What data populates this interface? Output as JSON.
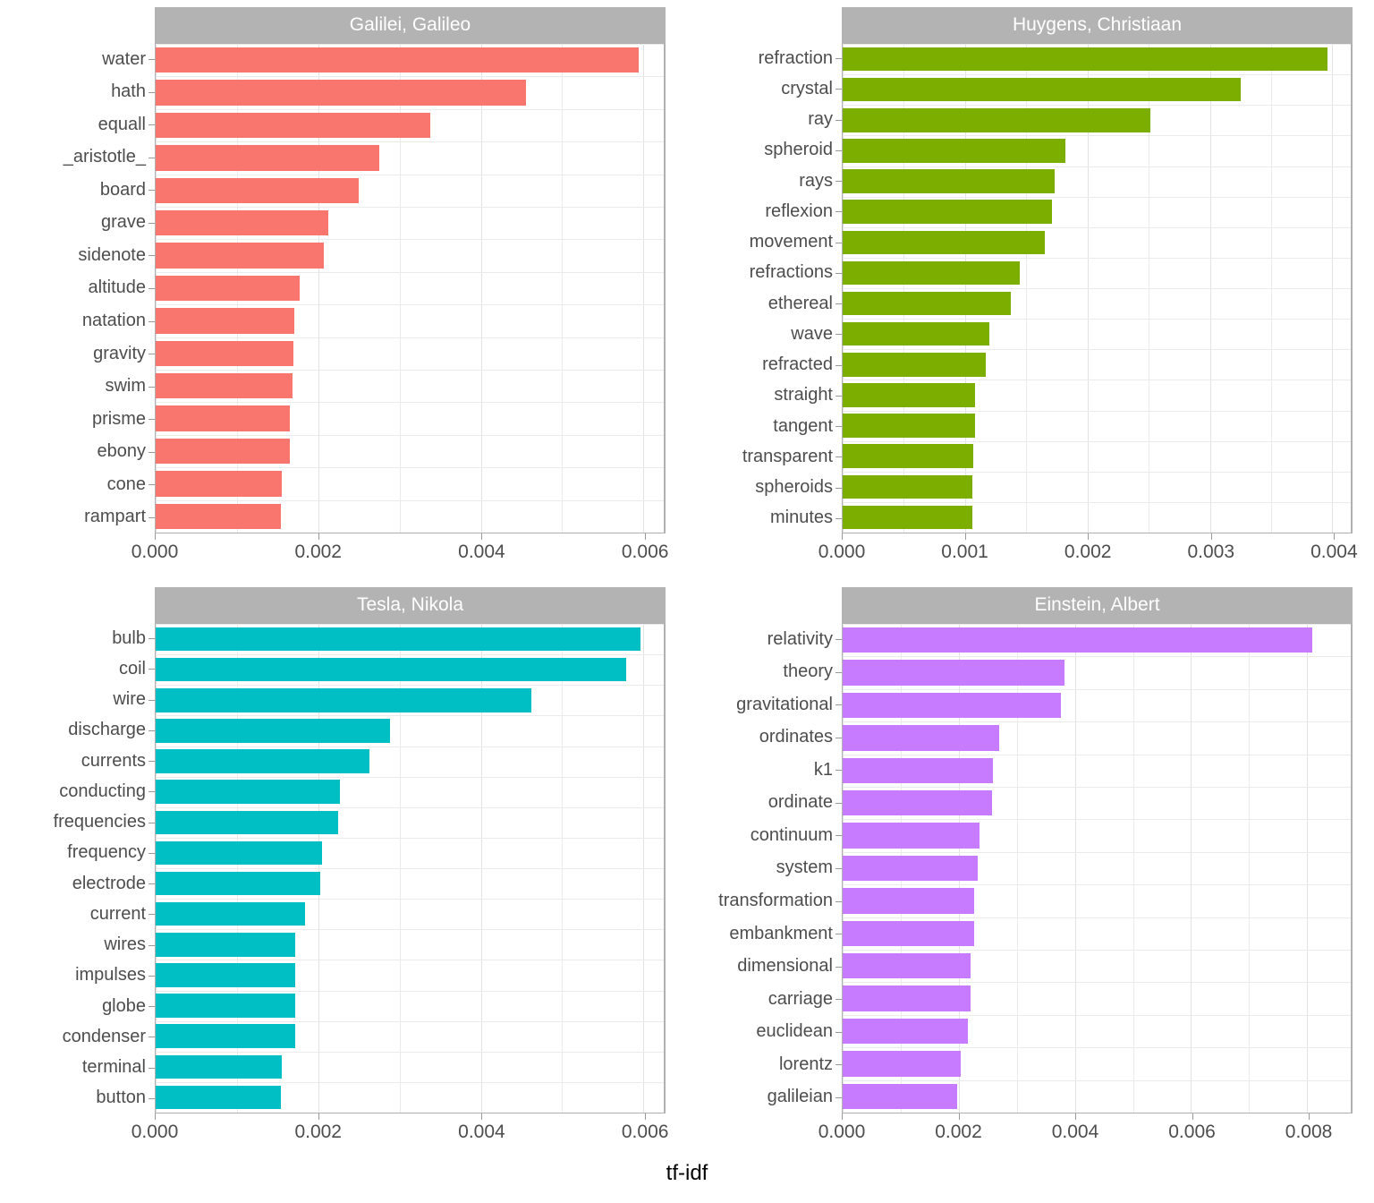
{
  "chart_data": {
    "type": "bar",
    "title": "",
    "xlabel": "tf-idf",
    "ylabel": "",
    "orientation": "horizontal",
    "facet_layout": "2x2",
    "grid": true,
    "legend": "none",
    "panels": [
      {
        "facet_label": "Galilei, Galileo",
        "color": "#F8766D",
        "xlim": [
          0,
          0.00625
        ],
        "xticks": [
          0.0,
          0.002,
          0.004,
          0.006
        ],
        "xtick_labels": [
          "0.000",
          "0.002",
          "0.004",
          "0.006"
        ],
        "categories": [
          "water",
          "hath",
          "equall",
          "_aristotle_",
          "board",
          "grave",
          "sidenote",
          "altitude",
          "natation",
          "gravity",
          "swim",
          "prisme",
          "ebony",
          "cone",
          "rampart"
        ],
        "values": [
          0.00594,
          0.00455,
          0.00338,
          0.00275,
          0.0025,
          0.00212,
          0.00207,
          0.00177,
          0.00171,
          0.0017,
          0.00168,
          0.00165,
          0.00165,
          0.00155,
          0.00154
        ]
      },
      {
        "facet_label": "Huygens, Christiaan",
        "color": "#7CAE00",
        "xlim": [
          0,
          0.00415
        ],
        "xticks": [
          0.0,
          0.001,
          0.002,
          0.003,
          0.004
        ],
        "xtick_labels": [
          "0.000",
          "0.001",
          "0.002",
          "0.003",
          "0.004"
        ],
        "categories": [
          "refraction",
          "crystal",
          "ray",
          "spheroid",
          "rays",
          "reflexion",
          "movement",
          "refractions",
          "ethereal",
          "wave",
          "refracted",
          "straight",
          "tangent",
          "transparent",
          "spheroids",
          "minutes"
        ],
        "values": [
          0.00396,
          0.00325,
          0.00251,
          0.00182,
          0.00173,
          0.00171,
          0.00165,
          0.00145,
          0.00137,
          0.0012,
          0.00117,
          0.00108,
          0.00108,
          0.00107,
          0.00106,
          0.00106
        ]
      },
      {
        "facet_label": "Tesla, Nikola",
        "color": "#00BFC4",
        "xlim": [
          0,
          0.00625
        ],
        "xticks": [
          0.0,
          0.002,
          0.004,
          0.006
        ],
        "xtick_labels": [
          "0.000",
          "0.002",
          "0.004",
          "0.006"
        ],
        "categories": [
          "bulb",
          "coil",
          "wire",
          "discharge",
          "currents",
          "conducting",
          "frequencies",
          "frequency",
          "electrode",
          "current",
          "wires",
          "impulses",
          "globe",
          "condenser",
          "terminal",
          "button"
        ],
        "values": [
          0.00596,
          0.00579,
          0.00462,
          0.00288,
          0.00263,
          0.00227,
          0.00224,
          0.00205,
          0.00203,
          0.00184,
          0.00172,
          0.00172,
          0.00172,
          0.00172,
          0.00155,
          0.00154
        ]
      },
      {
        "facet_label": "Einstein, Albert",
        "color": "#C77CFF",
        "xlim": [
          0,
          0.00875
        ],
        "xticks": [
          0.0,
          0.002,
          0.004,
          0.006,
          0.008
        ],
        "xtick_labels": [
          "0.000",
          "0.002",
          "0.004",
          "0.006",
          "0.008"
        ],
        "categories": [
          "relativity",
          "theory",
          "gravitational",
          "ordinates",
          "k1",
          "ordinate",
          "continuum",
          "system",
          "transformation",
          "embankment",
          "dimensional",
          "carriage",
          "euclidean",
          "lorentz",
          "galileian"
        ],
        "values": [
          0.00808,
          0.00382,
          0.00376,
          0.0027,
          0.00259,
          0.00257,
          0.00235,
          0.00233,
          0.00226,
          0.00226,
          0.0022,
          0.0022,
          0.00215,
          0.00203,
          0.00197
        ]
      }
    ]
  },
  "axis": {
    "x_title": "tf-idf"
  }
}
